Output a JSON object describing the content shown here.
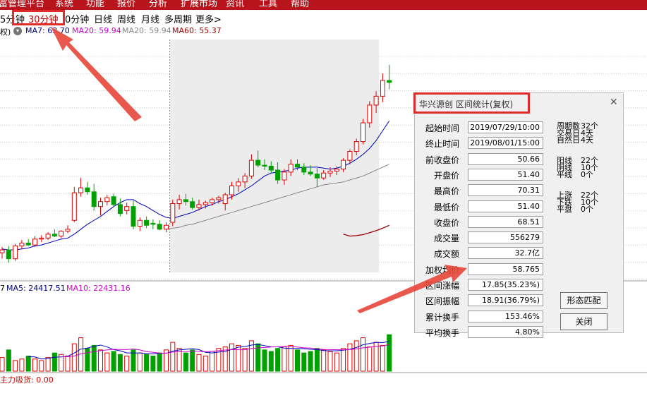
{
  "menu": [
    "富管理平台",
    "系统",
    "功能",
    "报价",
    "分析",
    "扩展市场",
    "资讯",
    "工具",
    "帮助"
  ],
  "periods": {
    "items": [
      "5分",
      "钟",
      "30分钟",
      "0分钟",
      "日线",
      "周线",
      "月线",
      "多周期",
      "更多>"
    ],
    "selected": "30分钟"
  },
  "indicator_line": {
    "prefix": "权)",
    "ma7": "MA7: 63.70",
    "ma20a": "MA20: 59.94",
    "ma20b": "MA20: 59.94",
    "ma60": "MA60: 55.37"
  },
  "volume_line": {
    "prefix": "7",
    "ma5": "MA5: 24417.51",
    "ma10": "MA10: 22431.16"
  },
  "bottom_indicator": "主力吸货: 0.00",
  "colors": {
    "up": "#e00000",
    "down": "#00a000",
    "ma7": "#0000c0",
    "ma20": "#cc00cc",
    "ma_gray": "#888888",
    "ma60": "#990000",
    "menubar": "#b8141c",
    "highlight": "#e02b2b"
  },
  "dialog": {
    "title": "华兴源创 区间统计(复权)",
    "rows": [
      {
        "label": "起始时间",
        "value": "2019/07/29/10:00"
      },
      {
        "label": "终止时间",
        "value": "2019/08/01/15:00"
      },
      {
        "label": "前收盘价",
        "value": "50.66"
      },
      {
        "label": "开盘价",
        "value": "51.40"
      },
      {
        "label": "最高价",
        "value": "70.31"
      },
      {
        "label": "最低价",
        "value": "51.40"
      },
      {
        "label": "收盘价",
        "value": "68.51"
      },
      {
        "label": "成交量",
        "value": "556279"
      },
      {
        "label": "成交额",
        "value": "32.7亿"
      },
      {
        "label": "加权均价",
        "value": "58.765"
      },
      {
        "label": "区间涨幅",
        "value": "17.85(35.23%)"
      },
      {
        "label": "区间振幅",
        "value": "18.91(36.79%)"
      },
      {
        "label": "累计换手",
        "value": "153.46%"
      },
      {
        "label": "平均换手",
        "value": "4.80%"
      }
    ],
    "stats": [
      {
        "label": "周期数",
        "value": "32个"
      },
      {
        "label": "交易日",
        "value": "4天"
      },
      {
        "label": "自然日",
        "value": "4天"
      },
      {
        "label": "阳线",
        "value": "22个"
      },
      {
        "label": "阴线",
        "value": "10个"
      },
      {
        "label": "平线",
        "value": "0个"
      },
      {
        "label": "上涨",
        "value": "22个"
      },
      {
        "label": "下跌",
        "value": "10个"
      },
      {
        "label": "平盘",
        "value": "0个"
      }
    ],
    "buttons": {
      "pattern": "形态匹配",
      "close": "关闭"
    }
  },
  "chart_data": {
    "type": "candlestick",
    "title": "",
    "selection": {
      "start_index": 26,
      "end_index": 57
    },
    "candles": [
      [
        51.2,
        51.8,
        50.6,
        51.5
      ],
      [
        51.5,
        51.9,
        50.2,
        50.6
      ],
      [
        50.6,
        52.1,
        50.4,
        51.9
      ],
      [
        51.9,
        52.5,
        51.6,
        52.2
      ],
      [
        52.2,
        52.6,
        51.9,
        52.0
      ],
      [
        52.0,
        52.9,
        51.8,
        52.6
      ],
      [
        52.6,
        53.0,
        52.3,
        52.7
      ],
      [
        52.7,
        53.3,
        52.5,
        53.1
      ],
      [
        53.1,
        53.6,
        52.8,
        52.9
      ],
      [
        52.9,
        53.5,
        52.7,
        53.4
      ],
      [
        53.4,
        54.0,
        53.2,
        53.6
      ],
      [
        54.5,
        57.9,
        54.3,
        57.3
      ],
      [
        57.3,
        58.8,
        56.9,
        57.8
      ],
      [
        57.8,
        58.4,
        57.1,
        57.4
      ],
      [
        57.4,
        58.2,
        55.5,
        55.9
      ],
      [
        55.9,
        56.8,
        55.0,
        56.4
      ],
      [
        56.4,
        57.1,
        56.0,
        56.8
      ],
      [
        56.9,
        57.2,
        55.8,
        56.1
      ],
      [
        56.1,
        56.7,
        54.9,
        55.2
      ],
      [
        55.5,
        56.3,
        55.1,
        55.9
      ],
      [
        55.9,
        56.5,
        53.6,
        53.9
      ],
      [
        53.9,
        54.8,
        53.4,
        54.5
      ],
      [
        54.5,
        54.9,
        53.7,
        54.0
      ],
      [
        54.2,
        54.6,
        53.6,
        54.1
      ],
      [
        54.1,
        54.5,
        53.5,
        53.6
      ],
      [
        53.6,
        54.3,
        53.3,
        54.0
      ],
      [
        54.3,
        56.6,
        53.9,
        56.2
      ],
      [
        56.2,
        57.1,
        55.6,
        56.6
      ],
      [
        56.6,
        57.2,
        56.0,
        56.4
      ],
      [
        56.4,
        56.8,
        55.6,
        55.8
      ],
      [
        55.8,
        56.6,
        55.5,
        56.1
      ],
      [
        56.1,
        56.5,
        55.7,
        56.3
      ],
      [
        56.3,
        56.8,
        56.0,
        56.6
      ],
      [
        56.6,
        57.0,
        56.2,
        56.8
      ],
      [
        56.2,
        57.3,
        55.5,
        57.1
      ],
      [
        57.1,
        58.4,
        56.6,
        58.0
      ],
      [
        58.0,
        58.8,
        57.4,
        58.4
      ],
      [
        58.4,
        59.3,
        57.8,
        59.0
      ],
      [
        59.0,
        61.2,
        58.7,
        60.6
      ],
      [
        60.6,
        61.6,
        59.9,
        60.1
      ],
      [
        60.1,
        60.7,
        59.6,
        60.0
      ],
      [
        60.0,
        60.5,
        59.3,
        59.6
      ],
      [
        59.6,
        60.4,
        58.2,
        58.6
      ],
      [
        58.6,
        59.7,
        58.1,
        59.4
      ],
      [
        59.4,
        60.7,
        59.0,
        60.2
      ],
      [
        60.2,
        60.7,
        59.6,
        59.9
      ],
      [
        59.9,
        60.3,
        59.1,
        59.4
      ],
      [
        59.4,
        60.1,
        59.0,
        59.2
      ],
      [
        59.2,
        59.8,
        57.9,
        58.8
      ],
      [
        58.8,
        59.6,
        58.6,
        59.3
      ],
      [
        59.3,
        59.9,
        58.9,
        59.5
      ],
      [
        59.5,
        60.0,
        59.1,
        59.7
      ],
      [
        59.7,
        60.8,
        59.4,
        60.6
      ],
      [
        60.6,
        61.7,
        60.2,
        61.5
      ],
      [
        61.5,
        62.8,
        61.1,
        62.5
      ],
      [
        62.5,
        64.8,
        62.2,
        64.4
      ],
      [
        64.4,
        66.6,
        63.9,
        66.2
      ],
      [
        66.2,
        67.6,
        65.4,
        67.1
      ],
      [
        67.1,
        69.4,
        66.5,
        68.7
      ],
      [
        68.7,
        70.3,
        67.8,
        68.5
      ]
    ],
    "ma7": [
      51.6,
      51.5,
      51.5,
      51.6,
      51.7,
      51.9,
      52.0,
      52.2,
      52.4,
      52.6,
      52.7,
      53.1,
      53.6,
      54.1,
      54.5,
      54.9,
      55.4,
      55.9,
      56.3,
      56.6,
      56.6,
      56.2,
      55.9,
      55.5,
      55.1,
      54.8,
      54.7,
      54.9,
      55.1,
      55.3,
      55.6,
      55.9,
      56.1,
      56.4,
      56.6,
      56.9,
      57.2,
      57.6,
      58.0,
      58.5,
      59.0,
      59.3,
      59.4,
      59.5,
      59.6,
      59.8,
      59.9,
      59.9,
      59.9,
      59.8,
      59.7,
      59.8,
      60.0,
      60.3,
      60.7,
      61.2,
      61.8,
      62.6,
      63.6,
      64.6
    ],
    "ma_gray": [
      null,
      null,
      null,
      null,
      null,
      null,
      null,
      null,
      null,
      null,
      null,
      null,
      null,
      null,
      null,
      null,
      null,
      null,
      null,
      null,
      null,
      null,
      null,
      null,
      null,
      53.6,
      53.7,
      53.8,
      54.0,
      54.1,
      54.3,
      54.5,
      54.7,
      54.9,
      55.1,
      55.3,
      55.5,
      55.7,
      55.9,
      56.1,
      56.3,
      56.5,
      56.7,
      56.9,
      57.1,
      57.3,
      57.5,
      57.7,
      57.9,
      58.1,
      58.2,
      58.3,
      58.4,
      58.6,
      58.8,
      59.0,
      59.3,
      59.6,
      59.9,
      60.2
    ],
    "ma60": [
      null,
      null,
      null,
      null,
      null,
      null,
      null,
      null,
      null,
      null,
      null,
      null,
      null,
      null,
      null,
      null,
      null,
      null,
      null,
      null,
      null,
      null,
      null,
      null,
      null,
      null,
      null,
      null,
      null,
      null,
      null,
      null,
      null,
      null,
      null,
      null,
      null,
      null,
      null,
      null,
      null,
      null,
      null,
      null,
      null,
      null,
      null,
      null,
      null,
      null,
      null,
      null,
      53.1,
      52.9,
      52.95,
      53.05,
      53.25,
      53.45,
      53.7,
      54.0
    ],
    "volume": [
      9,
      14,
      7,
      8,
      10,
      8,
      7,
      9,
      12,
      11,
      10,
      18,
      22,
      15,
      17,
      14,
      12,
      13,
      11,
      10,
      14,
      12,
      11,
      10,
      12,
      14,
      19,
      15,
      12,
      14,
      11,
      10,
      13,
      15,
      16,
      18,
      17,
      15,
      20,
      18,
      14,
      13,
      15,
      16,
      17,
      14,
      12,
      13,
      15,
      14,
      13,
      12,
      15,
      18,
      20,
      22,
      16,
      19,
      17,
      24
    ],
    "yrange": [
      48.5,
      73.0
    ]
  }
}
